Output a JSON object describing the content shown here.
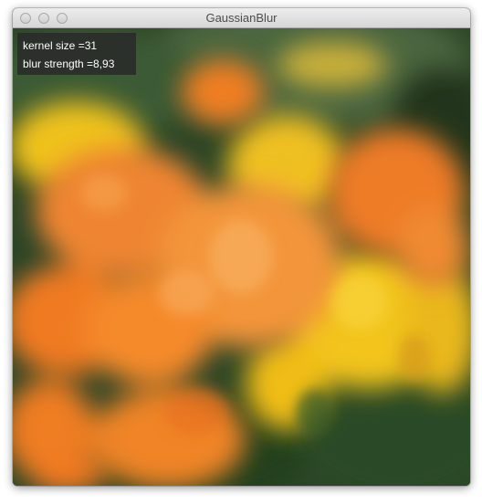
{
  "window": {
    "title": "GaussianBlur"
  },
  "overlay": {
    "kernel_size": "kernel size =31",
    "blur_strength": "blur strength =8,93"
  },
  "image": {
    "subject": "blurred-flowers-photo",
    "colors": {
      "background_green": "#2f4a2a",
      "orange": "#f08a2a",
      "yellow": "#f4c21a"
    }
  }
}
